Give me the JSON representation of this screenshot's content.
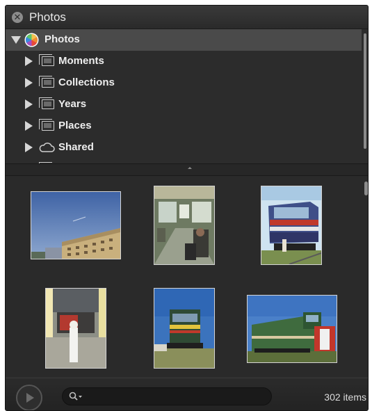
{
  "window": {
    "title": "Photos",
    "close_icon": "close-icon"
  },
  "sidebar": {
    "root": {
      "label": "Photos",
      "icon": "photos-app-icon",
      "expanded": true
    },
    "items": [
      {
        "label": "Moments",
        "icon": "folder-icon"
      },
      {
        "label": "Collections",
        "icon": "folder-icon"
      },
      {
        "label": "Years",
        "icon": "folder-icon"
      },
      {
        "label": "Places",
        "icon": "folder-icon"
      },
      {
        "label": "Shared",
        "icon": "cloud-icon"
      }
    ]
  },
  "grid": {
    "photos": [
      {
        "subject": "sky-building"
      },
      {
        "subject": "train-interior"
      },
      {
        "subject": "locomotive-front"
      },
      {
        "subject": "depot-person"
      },
      {
        "subject": "locomotive-yellow-stripe"
      },
      {
        "subject": "green-locomotive"
      }
    ]
  },
  "footer": {
    "play_icon": "play-icon",
    "search": {
      "value": "",
      "placeholder": "",
      "icon": "search-icon"
    },
    "item_count": "302 items"
  },
  "colors": {
    "panel_bg": "#2c2c2c",
    "selection_bg": "#4a4a4a",
    "text": "#eeeeee"
  }
}
